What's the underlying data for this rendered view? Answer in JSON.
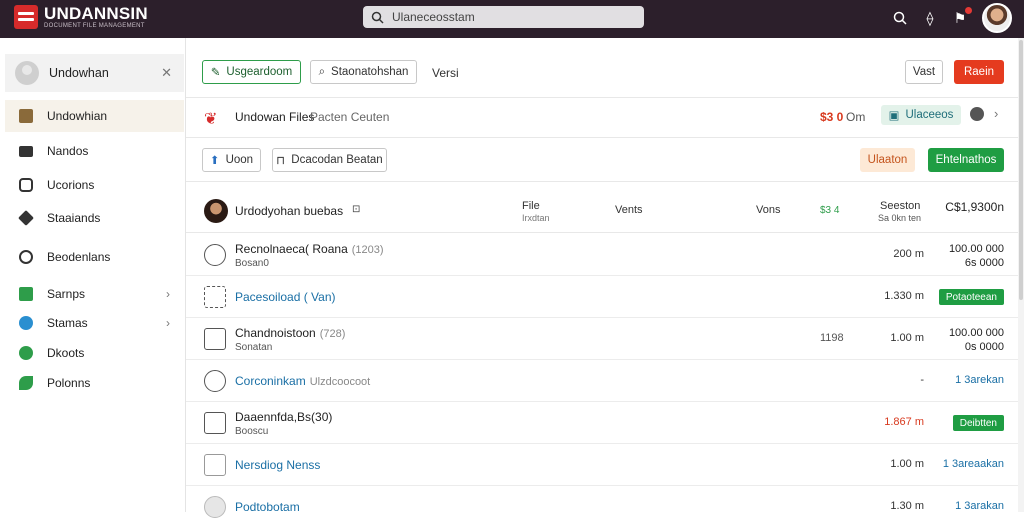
{
  "app": {
    "brand": "UNDANNSIN",
    "tagline": "DOCUMENT FILE MANAGEMENT",
    "search_value": "Ulaneceosstam"
  },
  "sidebar": {
    "profile_name": "Undowhan",
    "items": [
      {
        "label": "Undowhian",
        "icon": "briefcase-icon",
        "color": "#8a6a3a",
        "active": true
      },
      {
        "label": "Nandos",
        "icon": "folder-icon",
        "color": "#333333"
      },
      {
        "label": "Ucorions",
        "icon": "user-icon",
        "color": "#333333"
      },
      {
        "label": "Staaiands",
        "icon": "tag-icon",
        "color": "#333333"
      },
      {
        "label": "Beodenlans",
        "icon": "headset-icon",
        "color": "#333333"
      },
      {
        "label": "Sarnps",
        "icon": "green-square-icon",
        "color": "#2e9d4a",
        "chevron": true
      },
      {
        "label": "Stamas",
        "icon": "blue-circle-icon",
        "color": "#2a8fd0",
        "chevron": true
      },
      {
        "label": "Dkoots",
        "icon": "green-dot-icon",
        "color": "#2e9d4a"
      },
      {
        "label": "Polonns",
        "icon": "leaf-icon",
        "color": "#2e9d4a"
      }
    ]
  },
  "toolbar": {
    "primary_label": "Usgeardoom",
    "secondary_label": "Staonatohshan",
    "versi_label": "Versi",
    "vast_label": "Vast",
    "red_label": "Raein"
  },
  "file_header": {
    "title": "Undowan Files",
    "subtitle": "Pacten Ceuten",
    "price": "$3 0",
    "price_unit": "Om",
    "status_chip": "Ulaceeos"
  },
  "action_bar": {
    "left1": "Uoon",
    "left2": "Dcacodan Beatan",
    "peach": "Ulaaton",
    "green": "Ehtelnathos"
  },
  "table_header": {
    "name": "Urdodyohan buebas",
    "col_file": "File",
    "col_file_sub": "Irxdtan",
    "col_vents": "Vents",
    "col_vons": "Vons",
    "col_green": "$3 4",
    "col_seas": "Seeston",
    "col_seas_sub": "Sa 0kn ten",
    "col_total": "C$1,9300n"
  },
  "rows": [
    {
      "title": "Recnolnaeca( Roana",
      "sub_inline": "(1203)",
      "sub": "Bosan0",
      "icon": "headset-icon",
      "amount": "200 m",
      "total1": "100.00 000",
      "total2": "6s 0000",
      "kind": "total"
    },
    {
      "title": "Pacesoiload ( Van)",
      "icon": "qr-icon",
      "link": true,
      "amount": "1.330 m",
      "badge": "Potaoteean",
      "kind": "badge"
    },
    {
      "title": "Chandnoistoon",
      "sub_inline": "(728)",
      "sub": "Sonatan",
      "icon": "briefcase-icon",
      "mid": "1198",
      "amount": "1.00 m",
      "total1": "100.00 000",
      "total2": "0s 0000",
      "kind": "total"
    },
    {
      "title": "Corconinkam",
      "sub_inline": "Ulzdcoocoot",
      "icon": "clock-icon",
      "link": true,
      "amount": "-",
      "linkr": "1 3arekan",
      "kind": "linkr"
    },
    {
      "title": "Daaennfda,Bs(30)",
      "sub": "Booscu",
      "icon": "building-icon",
      "amount": "1.867 m",
      "amount_red": true,
      "badge": "Deibtten",
      "kind": "badge"
    },
    {
      "title": "Nersdiog Nenss",
      "icon": "box-icon",
      "link": true,
      "amount": "1.00 m",
      "linkr": "1 3areaakan",
      "kind": "linkr"
    },
    {
      "title": "Podtobotam",
      "icon": "globe-icon",
      "link": true,
      "amount": "1.30 m",
      "linkr": "1 3arakan",
      "kind": "linkr"
    }
  ]
}
